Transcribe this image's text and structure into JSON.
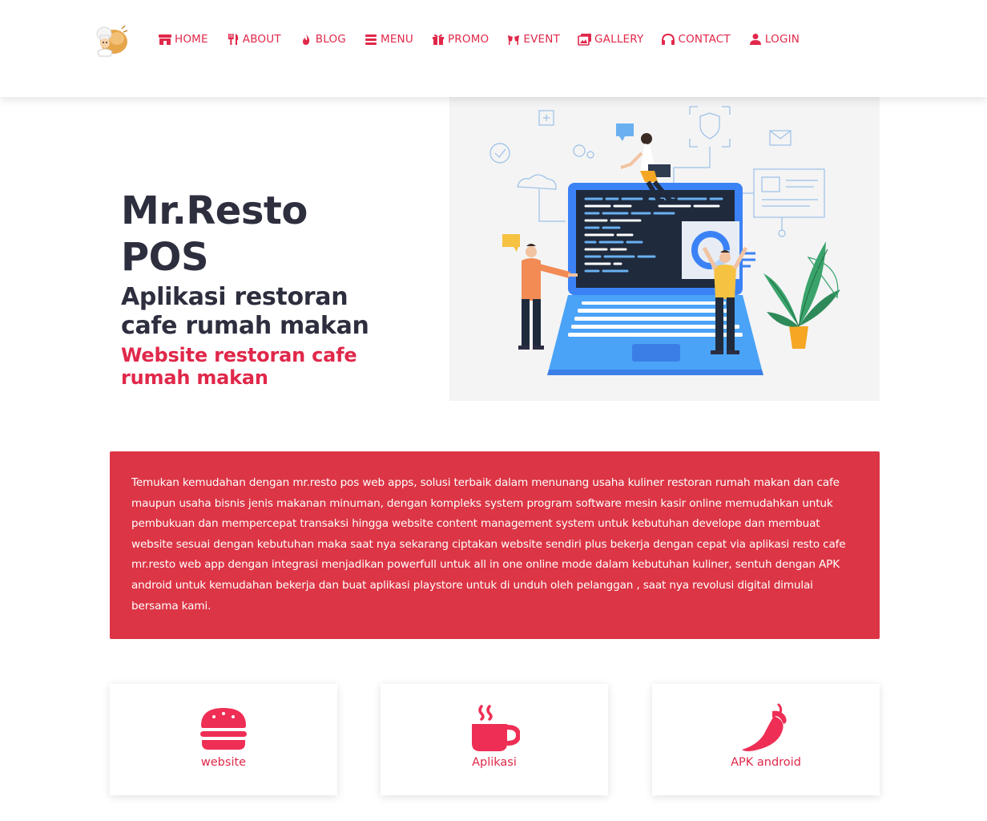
{
  "nav": {
    "items": [
      {
        "label": "HOME",
        "icon": "store-icon"
      },
      {
        "label": "ABOUT",
        "icon": "utensils-icon"
      },
      {
        "label": "BLOG",
        "icon": "fire-icon"
      },
      {
        "label": "MENU",
        "icon": "bars-icon"
      },
      {
        "label": "PROMO",
        "icon": "gift-icon"
      },
      {
        "label": "EVENT",
        "icon": "glasses-cheers-icon"
      },
      {
        "label": "GALLERY",
        "icon": "images-icon"
      },
      {
        "label": "CONTACT",
        "icon": "headphones-icon"
      },
      {
        "label": "LOGIN",
        "icon": "user-icon"
      }
    ]
  },
  "hero": {
    "title_line1": "Mr.Resto",
    "title_line2": "POS",
    "subtitle_line1": "Aplikasi restoran",
    "subtitle_line2": "cafe rumah makan",
    "tagline_line1": "Website restoran cafe",
    "tagline_line2": "rumah makan"
  },
  "intro": {
    "text": "Temukan kemudahan dengan mr.resto pos web apps, solusi terbaik dalam menunang usaha kuliner restoran rumah makan dan cafe maupun usaha bisnis jenis makanan minuman, dengan kompleks system program software mesin kasir online memudahkan untuk pembukuan dan mempercepat transaksi hingga website content management system untuk kebutuhan develope dan membuat website sesuai dengan kebutuhan maka saat nya sekarang ciptakan website sendiri plus bekerja dengan cepat via aplikasi resto cafe mr.resto web app dengan integrasi menjadikan powerfull untuk all in one online mode dalam kebutuhan kuliner, sentuh dengan APK android untuk kemudahan bekerja dan buat aplikasi playstore untuk di unduh oleh pelanggan , saat nya revolusi digital dimulai bersama kami."
  },
  "cards": [
    {
      "label": "website",
      "icon": "hamburger-icon"
    },
    {
      "label": "Aplikasi",
      "icon": "coffee-cup-icon"
    },
    {
      "label": "APK android",
      "icon": "pepper-icon"
    }
  ],
  "colors": {
    "accent": "#e0284a",
    "intro_bg": "#dc3545",
    "heading": "#2d2e3e"
  }
}
